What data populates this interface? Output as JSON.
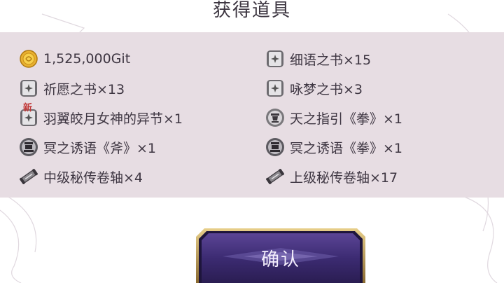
{
  "title": "获得道具",
  "rewards": [
    {
      "label": "1,525,000Git",
      "icon": "gold-coin-icon"
    },
    {
      "label": "细语之书×15",
      "icon": "book-icon"
    },
    {
      "label": "祈愿之书×13",
      "icon": "book-icon"
    },
    {
      "label": "咏梦之书×3",
      "icon": "book-icon"
    },
    {
      "label": "羽翼皎月女神的异节×1",
      "icon": "book-icon",
      "badge": "新"
    },
    {
      "label": "天之指引《拳》×1",
      "icon": "fist-emblem-icon"
    },
    {
      "label": "冥之诱语《斧》×1",
      "icon": "dark-emblem-icon"
    },
    {
      "label": "冥之诱语《拳》×1",
      "icon": "dark-emblem-icon"
    },
    {
      "label": "中级秘传卷轴×4",
      "icon": "scroll-icon"
    },
    {
      "label": "上级秘传卷轴×17",
      "icon": "scroll-icon"
    }
  ],
  "confirm_label": "确认",
  "colors": {
    "panel": "#e7dde3",
    "text": "#3e3642",
    "button": "#3a2a6a",
    "button_border": "#b08a4a"
  }
}
